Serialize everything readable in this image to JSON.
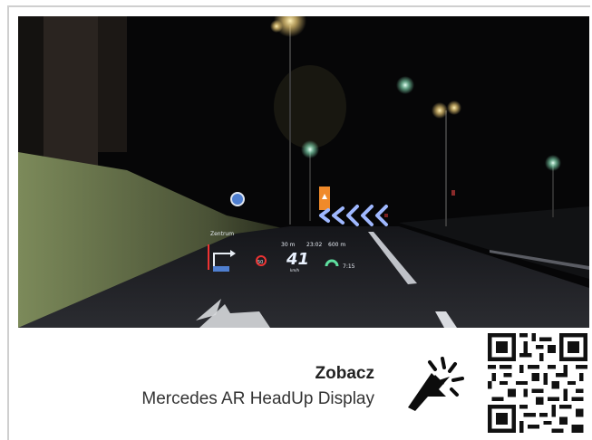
{
  "caption": {
    "title": "Zobacz",
    "subtitle": "Mercedes AR HeadUp Display"
  },
  "hud": {
    "street_name": "Zentrum",
    "distance_info": "30 m",
    "clock": "23:02",
    "distance_remaining": "600 m",
    "speed": "41",
    "speed_unit": "km/h",
    "speed_limit": "50",
    "time_small": "7:15"
  },
  "icons": {
    "cursor": "click-cursor-icon",
    "qr": "qr-code-icon",
    "chevrons": "chevron-left-icon"
  },
  "colors": {
    "night_sky": "#070708",
    "road": "#1a1b1f",
    "grass": "#6f7a52",
    "street_light": "#f4d27a",
    "traffic_green": "#8ef0c3",
    "hud_blue": "#9fb8ff",
    "warning_orange": "#f08a2a"
  }
}
